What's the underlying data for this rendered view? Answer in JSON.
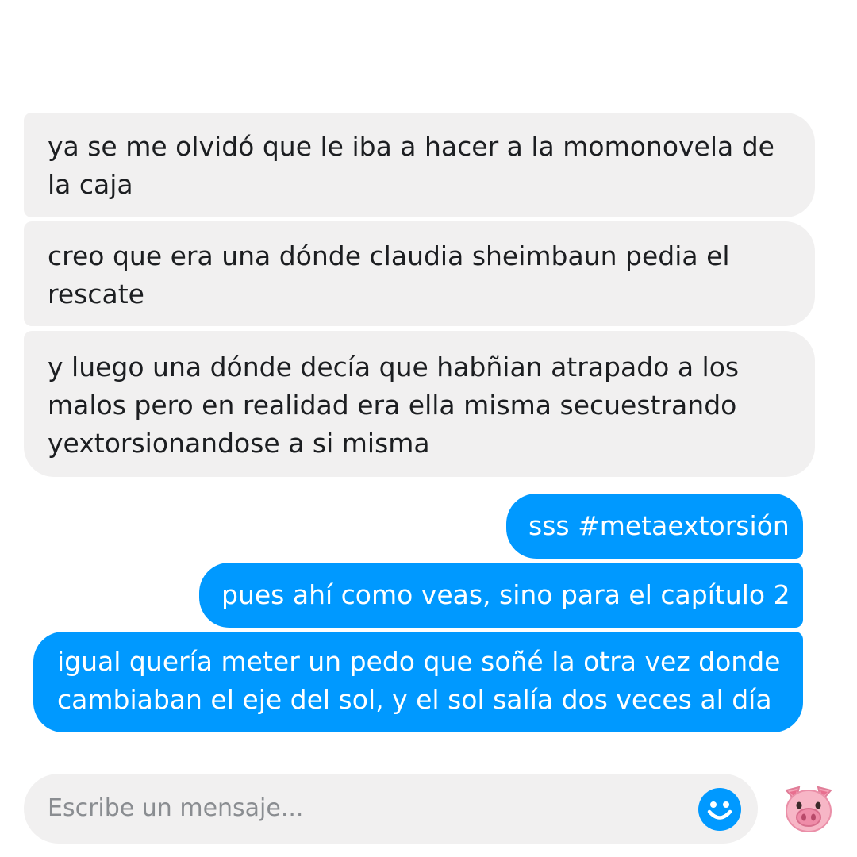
{
  "messages": [
    {
      "direction": "incoming",
      "text": "ya se me olvidó que le iba a hacer a la momonovela de la caja"
    },
    {
      "direction": "incoming",
      "text": "creo que era una dónde claudia sheimbaun pedia el rescate"
    },
    {
      "direction": "incoming",
      "text": "y luego una dónde decía que habñian atrapado a los malos pero en realidad era ella misma secuestrando yextorsionandose a si misma"
    },
    {
      "direction": "outgoing",
      "text": "sss #metaextorsión"
    },
    {
      "direction": "outgoing",
      "text": "pues ahí como veas, sino para el capítulo 2"
    },
    {
      "direction": "outgoing",
      "text": "igual quería meter un pedo que soñé la otra vez donde cambiaban el eje del sol, y el sol salía dos veces al día"
    }
  ],
  "composer": {
    "placeholder": "Escribe un mensaje...",
    "emoji_icon": "smiley-face-icon",
    "reaction_icon": "pig-face-emoji-icon"
  },
  "colors": {
    "incoming_bubble": "#f1f0f0",
    "outgoing_bubble": "#0099ff",
    "accent": "#0099ff"
  }
}
